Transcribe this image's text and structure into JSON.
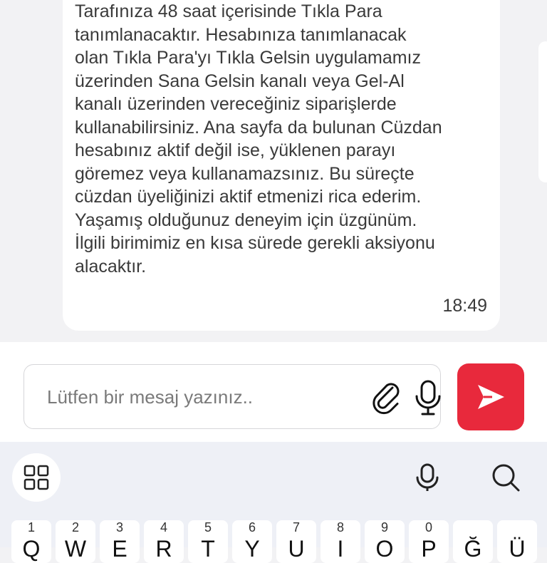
{
  "message": {
    "text": "Tarafınıza 48 saat içerisinde Tıkla Para\ntanımlanacaktır. Hesabınıza tanımlanacak\nolan Tıkla Para'yı Tıkla Gelsin uygulamamız\nüzerinden Sana Gelsin kanalı veya Gel-Al\nkanalı üzerinden vereceğiniz siparişlerde\nkullanabilirsiniz. Ana sayfa da bulunan Cüzdan\nhesabınız aktif değil ise, yüklenen parayı\ngöremez veya kullanamazsınız. Bu süreçte\ncüzdan üyeliğinizi aktif etmenizi rica ederim.\nYaşamış olduğunuz deneyim için üzgünüm.\nİlgili birimimiz en kısa sürede gerekli aksiyonu\nalacaktır.",
    "time": "18:49"
  },
  "composer": {
    "placeholder": "Lütfen bir mesaj yazınız..",
    "attach_icon": "paperclip-icon",
    "mic_icon": "microphone-icon",
    "send_icon": "send-arrow-icon",
    "send_color": "#e8293c"
  },
  "keyboard": {
    "toolbar_icons": [
      "apps-grid-icon",
      "microphone-icon",
      "search-icon"
    ],
    "number_hints": [
      "1",
      "2",
      "3",
      "4",
      "5",
      "6",
      "7",
      "8",
      "9",
      "0"
    ],
    "keys": [
      "Q",
      "W",
      "E",
      "R",
      "T",
      "Y",
      "U",
      "I",
      "O",
      "P",
      "Ğ",
      "Ü"
    ]
  }
}
